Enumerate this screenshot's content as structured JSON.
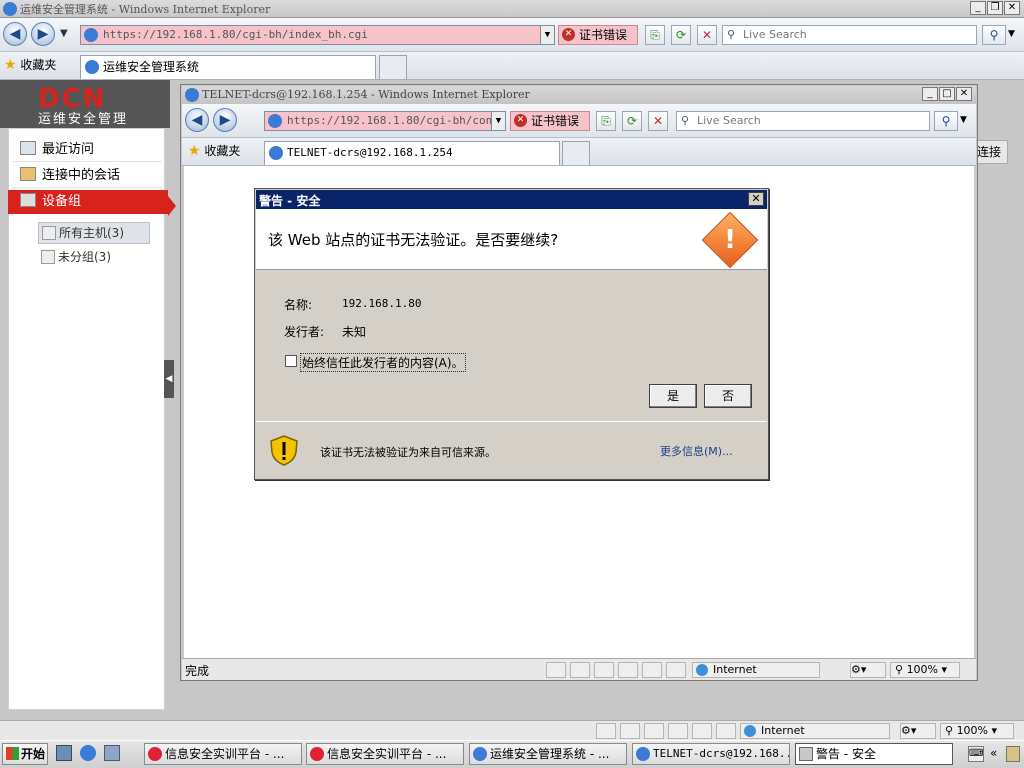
{
  "outer_window": {
    "title": "运维安全管理系统 - Windows Internet Explorer",
    "address": "https://192.168.1.80/cgi-bh/index_bh.cgi",
    "cert_error": "证书错误",
    "search_placeholder": "Live Search",
    "favorites_label": "收藏夹",
    "tab_title": "运维安全管理系统",
    "status_zone": "Internet",
    "zoom": "100%"
  },
  "app": {
    "logo": "DCN",
    "subtitle": "运维安全管理",
    "sidebar": {
      "items": [
        {
          "label": "最近访问"
        },
        {
          "label": "连接中的会话"
        },
        {
          "label": "设备组"
        }
      ],
      "tree": [
        {
          "label": "所有主机(3)"
        },
        {
          "label": "未分组(3)"
        }
      ]
    },
    "right_button": "连接"
  },
  "inner_window": {
    "title": "TELNET-dcrs@192.168.1.254 - Windows Internet Explorer",
    "address": "https://192.168.1.80/cgi-bh/contr",
    "cert_error": "证书错误",
    "search_placeholder": "Live Search",
    "favorites_label": "收藏夹",
    "tab_title": "TELNET-dcrs@192.168.1.254",
    "status_done": "完成",
    "status_zone": "Internet",
    "zoom": "100%"
  },
  "dialog": {
    "title": "警告 - 安全",
    "heading": "该 Web 站点的证书无法验证。是否要继续?",
    "name_label": "名称:",
    "name_value": "192.168.1.80",
    "issuer_label": "发行者:",
    "issuer_value": "未知",
    "checkbox_label": "始终信任此发行者的内容(A)。",
    "yes": "是",
    "no": "否",
    "footer_text": "该证书无法被验证为来自可信来源。",
    "more_info": "更多信息(M)..."
  },
  "taskbar": {
    "start": "开始",
    "tasks": [
      {
        "label": "信息安全实训平台 - ..."
      },
      {
        "label": "信息安全实训平台 - ..."
      },
      {
        "label": "运维安全管理系统 - ..."
      },
      {
        "label": "TELNET-dcrs@192.168..."
      },
      {
        "label": "警告 - 安全"
      }
    ]
  },
  "colors": {
    "dialog_title_bg": "#0a246a",
    "cert_error_bg": "#f6c3cb",
    "sidebar_active": "#d8231c"
  }
}
